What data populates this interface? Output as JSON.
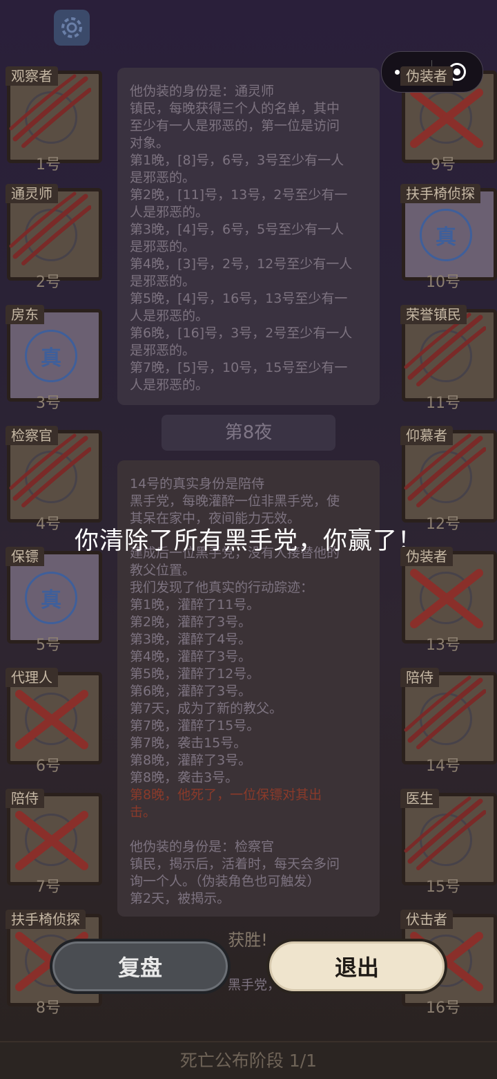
{
  "capsule": {
    "more_icon": "more-dots-icon",
    "close_icon": "target-close-icon"
  },
  "left_players": [
    {
      "role": "观察者",
      "num": "1号",
      "state": "claw"
    },
    {
      "role": "通灵师",
      "num": "2号",
      "state": "claw"
    },
    {
      "role": "房东",
      "num": "3号",
      "state": "true"
    },
    {
      "role": "检察官",
      "num": "4号",
      "state": "claw"
    },
    {
      "role": "保镖",
      "num": "5号",
      "state": "true"
    },
    {
      "role": "代理人",
      "num": "6号",
      "state": "cross"
    },
    {
      "role": "陪侍",
      "num": "7号",
      "state": "cross"
    },
    {
      "role": "扶手椅侦探",
      "num": "8号",
      "state": "cross"
    }
  ],
  "right_players": [
    {
      "role": "伪装者",
      "num": "9号",
      "state": "cross"
    },
    {
      "role": "扶手椅侦探",
      "num": "10号",
      "state": "true"
    },
    {
      "role": "荣誉镇民",
      "num": "11号",
      "state": "claw"
    },
    {
      "role": "仰慕者",
      "num": "12号",
      "state": "claw"
    },
    {
      "role": "伪装者",
      "num": "13号",
      "state": "cross"
    },
    {
      "role": "陪侍",
      "num": "14号",
      "state": "claw"
    },
    {
      "role": "医生",
      "num": "15号",
      "state": "claw"
    },
    {
      "role": "伏击者",
      "num": "16号",
      "state": "cross"
    }
  ],
  "true_badge": "真",
  "log1": [
    "他伪装的身份是：通灵师",
    "镇民，每晚获得三个人的名单，其中",
    "至少有一人是邪恶的，第一位是访问",
    "对象。",
    "第1晚，[8]号，6号，3号至少有一人",
    "是邪恶的。",
    "第2晚，[11]号，13号，2号至少有一",
    "人是邪恶的。",
    "第3晚，[4]号，6号，5号至少有一人",
    "是邪恶的。",
    "第4晚，[3]号，2号，12号至少有一人",
    "是邪恶的。",
    "第5晚，[4]号，16号，13号至少有一",
    "人是邪恶的。",
    "第6晚，[16]号，3号，2号至少有一人",
    "是邪恶的。",
    "第7晚，[5]号，10号，15号至少有一",
    "人是邪恶的。"
  ],
  "night_label": "第8夜",
  "log2": [
    {
      "t": "14号的真实身份是陪侍",
      "red": false
    },
    {
      "t": "黑手党，每晚灌醉一位非黑手党，使",
      "red": false
    },
    {
      "t": "其呆在家中，夜间能力无效。",
      "red": false
    },
    {
      "t": "",
      "red": false
    },
    {
      "t": "建成后一位黑手党，没有人接替他的",
      "red": false
    },
    {
      "t": "教父位置。",
      "red": false
    },
    {
      "t": "我们发现了他真实的行动踪迹：",
      "red": false
    },
    {
      "t": "第1晚，灌醉了11号。",
      "red": false
    },
    {
      "t": "第2晚，灌醉了3号。",
      "red": false
    },
    {
      "t": "第3晚，灌醉了4号。",
      "red": false
    },
    {
      "t": "第4晚，灌醉了3号。",
      "red": false
    },
    {
      "t": "第5晚，灌醉了12号。",
      "red": false
    },
    {
      "t": "第6晚，灌醉了3号。",
      "red": false
    },
    {
      "t": "第7天，成为了新的教父。",
      "red": false
    },
    {
      "t": "第7晚，灌醉了15号。",
      "red": false
    },
    {
      "t": "第7晚，袭击15号。",
      "red": false
    },
    {
      "t": "第8晚，灌醉了3号。",
      "red": false
    },
    {
      "t": "第8晚，袭击3号。",
      "red": false
    },
    {
      "t": "第8晚，他死了，一位保镖对其出",
      "red": true
    },
    {
      "t": "击。",
      "red": true
    },
    {
      "t": "",
      "red": false
    },
    {
      "t": "他伪装的身份是：检察官",
      "red": false
    },
    {
      "t": "镇民，揭示后，活着时，每天会多问",
      "red": false
    },
    {
      "t": "询一个人。（伪装角色也可触发）",
      "red": false
    },
    {
      "t": "第2天，被揭示。",
      "red": false
    }
  ],
  "win_label": "获胜!",
  "under_text": "黑手党，",
  "message": "你清除了所有黑手党，你赢了！",
  "buttons": {
    "replay": "复盘",
    "exit": "退出"
  },
  "phase": "死亡公布阶段 1/1"
}
